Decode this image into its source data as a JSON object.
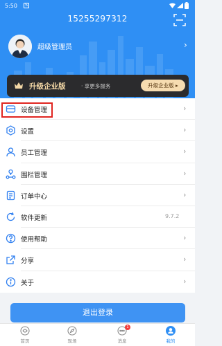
{
  "status_bar": {
    "time": "5:50",
    "badge": "S"
  },
  "header": {
    "phone": "15255297312",
    "username": "超级管理员"
  },
  "upgrade": {
    "title": "升级企业版",
    "subtitle": "· 享更多服务",
    "button": "升级企业版 ▸"
  },
  "menu": [
    {
      "label": "设备管理",
      "icon": "device-icon"
    },
    {
      "label": "设置",
      "icon": "gear-icon"
    },
    {
      "label": "员工管理",
      "icon": "person-icon"
    },
    {
      "label": "围栏管理",
      "icon": "fence-icon"
    },
    {
      "label": "订单中心",
      "icon": "order-icon"
    },
    {
      "label": "软件更新",
      "icon": "refresh-icon",
      "version": "9.7.2"
    },
    {
      "label": "使用帮助",
      "icon": "help-icon"
    },
    {
      "label": "分享",
      "icon": "share-icon"
    },
    {
      "label": "关于",
      "icon": "info-icon"
    }
  ],
  "logout": "退出登录",
  "tabs": [
    {
      "label": "首页",
      "icon": "home-icon"
    },
    {
      "label": "现场",
      "icon": "compass-icon"
    },
    {
      "label": "消息",
      "icon": "message-icon",
      "badge": "1"
    },
    {
      "label": "我的",
      "icon": "profile-icon",
      "active": true
    }
  ],
  "colors": {
    "primary": "#2f8ff4",
    "highlight": "#e0241f",
    "banner": "#2b2b2d",
    "gold": "#f6dcb0"
  }
}
